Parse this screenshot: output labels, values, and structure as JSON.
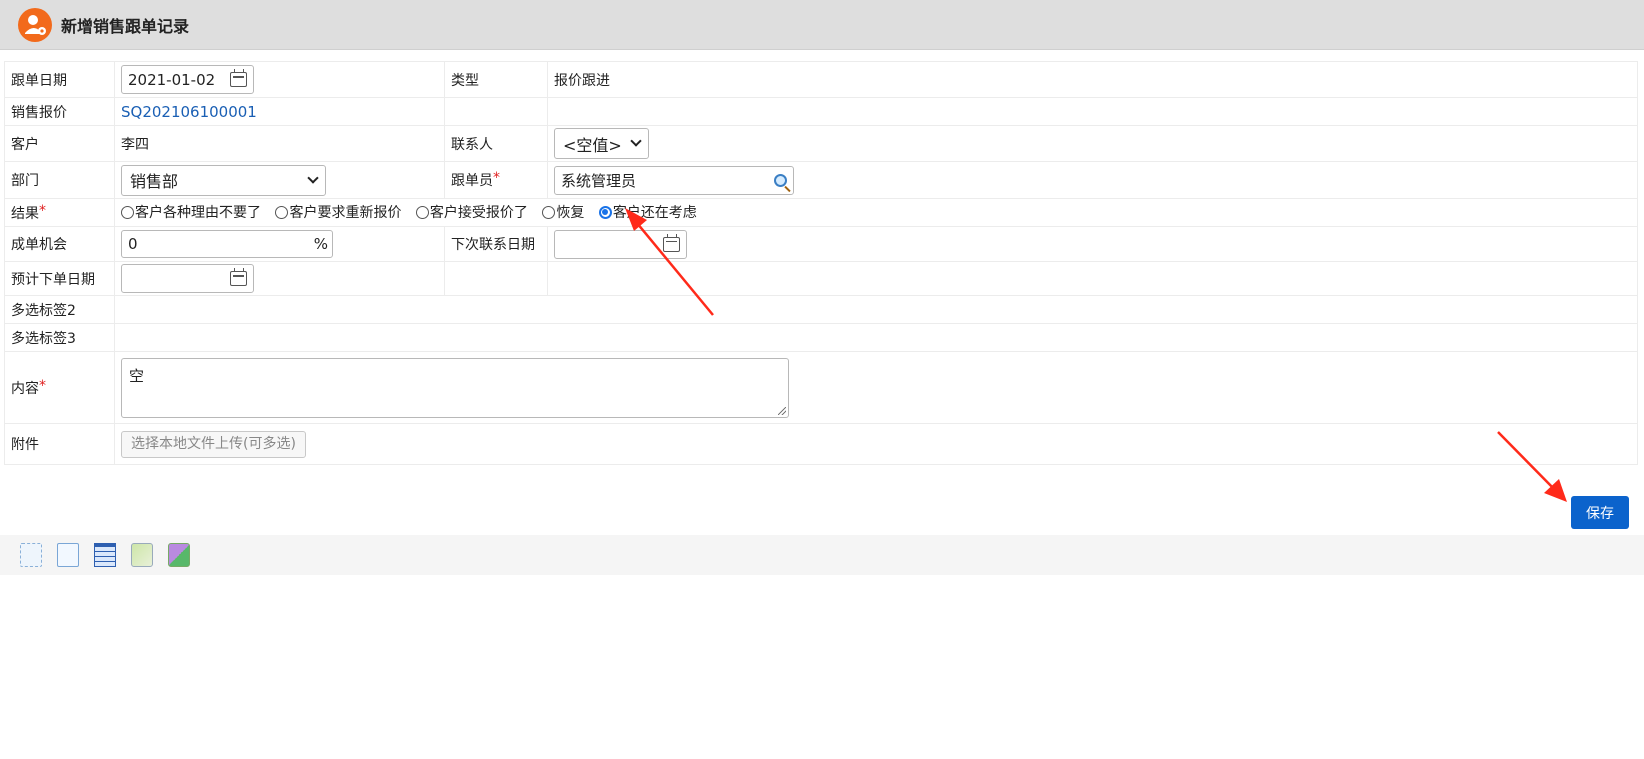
{
  "window": {
    "title": "新增销售跟单记录"
  },
  "form": {
    "follow_date": {
      "label": "跟单日期",
      "value": "2021-01-02"
    },
    "type": {
      "label": "类型",
      "value": "报价跟进"
    },
    "quote": {
      "label": "销售报价",
      "value": "SQ202106100001"
    },
    "customer": {
      "label": "客户",
      "value": "李四"
    },
    "contact": {
      "label": "联系人",
      "value": "<空值>"
    },
    "department": {
      "label": "部门",
      "value": "销售部"
    },
    "follower": {
      "label": "跟单员",
      "value": "系统管理员"
    },
    "result": {
      "label": "结果",
      "options": [
        "客户各种理由不要了",
        "客户要求重新报价",
        "客户接受报价了",
        "恢复",
        "客户还在考虑"
      ],
      "selected": "客户还在考虑"
    },
    "chance": {
      "label": "成单机会",
      "value": "0",
      "unit": "%"
    },
    "next_contact_date": {
      "label": "下次联系日期",
      "value": ""
    },
    "expected_order_date": {
      "label": "预计下单日期",
      "value": ""
    },
    "tag2": {
      "label": "多选标签2"
    },
    "tag3": {
      "label": "多选标签3"
    },
    "content": {
      "label": "内容",
      "value": "空"
    },
    "attachment": {
      "label": "附件",
      "button": "选择本地文件上传(可多选)"
    },
    "required_mark": "*"
  },
  "actions": {
    "save": "保存"
  },
  "toolbar_icons": [
    "blank-page-icon",
    "document-icon",
    "table-icon",
    "brush-icon",
    "puzzle-icon"
  ],
  "colors": {
    "accent": "#0b63cc",
    "link": "#1a5fb4",
    "required": "#e02020",
    "annotation_arrow": "#ff2a1a",
    "app_icon": "#f26a1b"
  }
}
